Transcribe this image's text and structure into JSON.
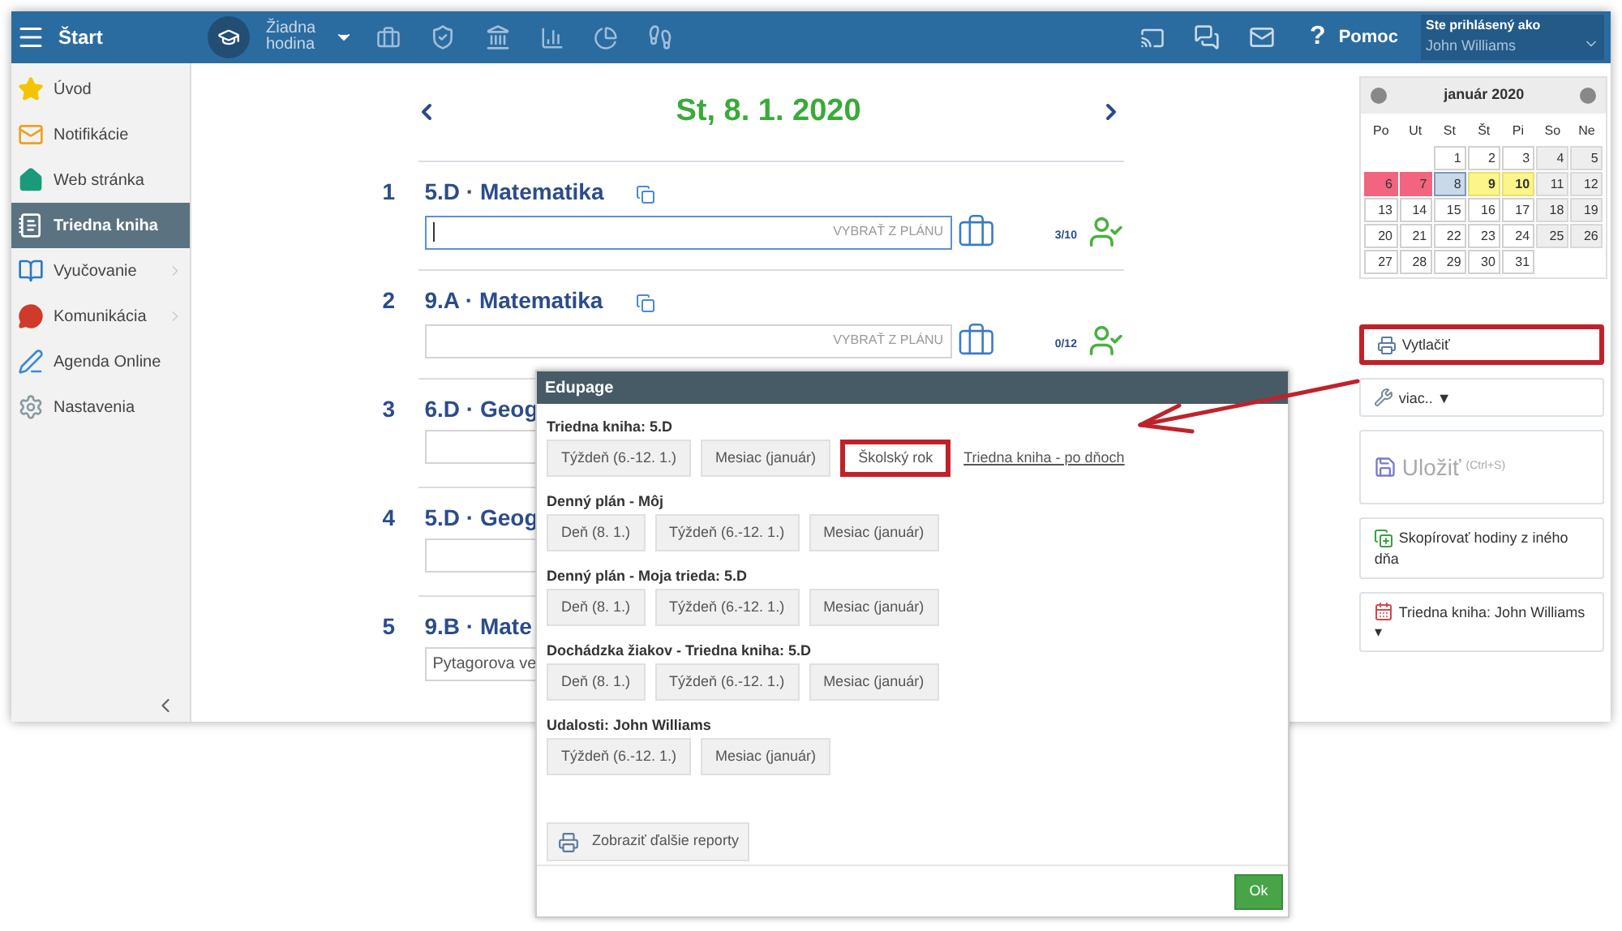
{
  "topbar": {
    "menu_label": "Štart",
    "lesson_selector": "Žiadna hodina",
    "help_glyph": "?",
    "help": "Pomoc",
    "login_caption": "Ste prihlásený ako",
    "user": "John Williams"
  },
  "sidebar": {
    "items": [
      {
        "label": "Úvod",
        "kind": "star",
        "selected": false,
        "submenu": false
      },
      {
        "label": "Notifikácie",
        "kind": "mail",
        "selected": false,
        "submenu": false
      },
      {
        "label": "Web stránka",
        "kind": "home",
        "selected": false,
        "submenu": false
      },
      {
        "label": "Triedna kniha",
        "kind": "notebook",
        "selected": true,
        "submenu": false
      },
      {
        "label": "Vyučovanie",
        "kind": "book",
        "selected": false,
        "submenu": true
      },
      {
        "label": "Komunikácia",
        "kind": "chat",
        "selected": false,
        "submenu": true
      },
      {
        "label": "Agenda Online",
        "kind": "pen",
        "selected": false,
        "submenu": false
      },
      {
        "label": "Nastavenia",
        "kind": "gear",
        "selected": false,
        "submenu": false
      }
    ]
  },
  "day": {
    "title": "St, 8. 1. 2020"
  },
  "lessons": [
    {
      "number": "1",
      "title": "5.D · Matematika",
      "focused": true,
      "plan_button": "VYBRAŤ Z PLÁNU",
      "count": "3/10"
    },
    {
      "number": "2",
      "title": "9.A · Matematika",
      "focused": false,
      "plan_button": "VYBRAŤ Z PLÁNU",
      "count": "0/12"
    },
    {
      "number": "3",
      "title": "6.D · Geog",
      "focused": false
    },
    {
      "number": "4",
      "title": "5.D · Geog",
      "focused": false
    },
    {
      "number": "5",
      "title": "9.B · Mate",
      "focused": false,
      "value": "Pytagorova ve"
    }
  ],
  "calendar": {
    "month": "január 2020",
    "weekdays": [
      "Po",
      "Ut",
      "St",
      "Št",
      "Pi",
      "So",
      "Ne"
    ],
    "weeks": [
      [
        {
          "day": "1",
          "kind": "normal"
        },
        {
          "day": "2",
          "kind": "normal"
        },
        {
          "day": "3",
          "kind": "normal"
        },
        {
          "day": "4",
          "kind": "weekend"
        },
        {
          "day": "5",
          "kind": "weekend"
        }
      ],
      [
        {
          "day": "6",
          "kind": "red"
        },
        {
          "day": "7",
          "kind": "red"
        },
        {
          "day": "8",
          "kind": "selected"
        },
        {
          "day": "9",
          "kind": "yellow"
        },
        {
          "day": "10",
          "kind": "yellow"
        },
        {
          "day": "11",
          "kind": "weekend"
        },
        {
          "day": "12",
          "kind": "weekend"
        }
      ],
      [
        {
          "day": "13",
          "kind": "normal"
        },
        {
          "day": "14",
          "kind": "normal"
        },
        {
          "day": "15",
          "kind": "normal"
        },
        {
          "day": "16",
          "kind": "normal"
        },
        {
          "day": "17",
          "kind": "normal"
        },
        {
          "day": "18",
          "kind": "weekend"
        },
        {
          "day": "19",
          "kind": "weekend"
        }
      ],
      [
        {
          "day": "20",
          "kind": "normal"
        },
        {
          "day": "21",
          "kind": "normal"
        },
        {
          "day": "22",
          "kind": "normal"
        },
        {
          "day": "23",
          "kind": "normal"
        },
        {
          "day": "24",
          "kind": "normal"
        },
        {
          "day": "25",
          "kind": "weekend"
        },
        {
          "day": "26",
          "kind": "weekend"
        }
      ],
      [
        {
          "day": "27",
          "kind": "normal"
        },
        {
          "day": "28",
          "kind": "normal"
        },
        {
          "day": "29",
          "kind": "normal"
        },
        {
          "day": "30",
          "kind": "normal"
        },
        {
          "day": "31",
          "kind": "normal"
        }
      ]
    ]
  },
  "actions": [
    {
      "kind": "print",
      "label": "Vytlačiť",
      "highlighted": true
    },
    {
      "kind": "more",
      "label": "viac.. ▼",
      "highlighted": false
    },
    {
      "kind": "save",
      "label": "Uložiť",
      "hint": "(Ctrl+S)",
      "highlighted": false
    },
    {
      "kind": "copy",
      "label": "Skopírovať hodiny z iného dňa",
      "highlighted": false
    },
    {
      "kind": "book",
      "label": "Triedna kniha: John Williams ▾",
      "highlighted": false
    }
  ],
  "dialog": {
    "title": "Edupage",
    "groups": [
      {
        "heading": "Triedna kniha: 5.D",
        "buttons": [
          {
            "label": "Týždeň (6.-12. 1.)",
            "highlighted": false
          },
          {
            "label": "Mesiac (január)",
            "highlighted": false
          },
          {
            "label": "Školský rok",
            "highlighted": true
          }
        ],
        "link": "Triedna kniha - po dňoch"
      },
      {
        "heading": "Denný plán - Môj",
        "buttons": [
          {
            "label": "Deň (8. 1.)",
            "highlighted": false
          },
          {
            "label": "Týždeň (6.-12. 1.)",
            "highlighted": false
          },
          {
            "label": "Mesiac (január)",
            "highlighted": false
          }
        ]
      },
      {
        "heading": "Denný plán - Moja trieda: 5.D",
        "buttons": [
          {
            "label": "Deň (8. 1.)",
            "highlighted": false
          },
          {
            "label": "Týždeň (6.-12. 1.)",
            "highlighted": false
          },
          {
            "label": "Mesiac (január)",
            "highlighted": false
          }
        ]
      },
      {
        "heading": "Dochádzka žiakov - Triedna kniha: 5.D",
        "buttons": [
          {
            "label": "Deň (8. 1.)",
            "highlighted": false
          },
          {
            "label": "Týždeň (6.-12. 1.)",
            "highlighted": false
          },
          {
            "label": "Mesiac (január)",
            "highlighted": false
          }
        ]
      },
      {
        "heading": "Udalosti: John Williams",
        "buttons": [
          {
            "label": "Týždeň (6.-12. 1.)",
            "highlighted": false
          },
          {
            "label": "Mesiac (január)",
            "highlighted": false
          }
        ]
      }
    ],
    "more_button": "Zobraziť ďalšie reporty",
    "ok": "Ok"
  }
}
